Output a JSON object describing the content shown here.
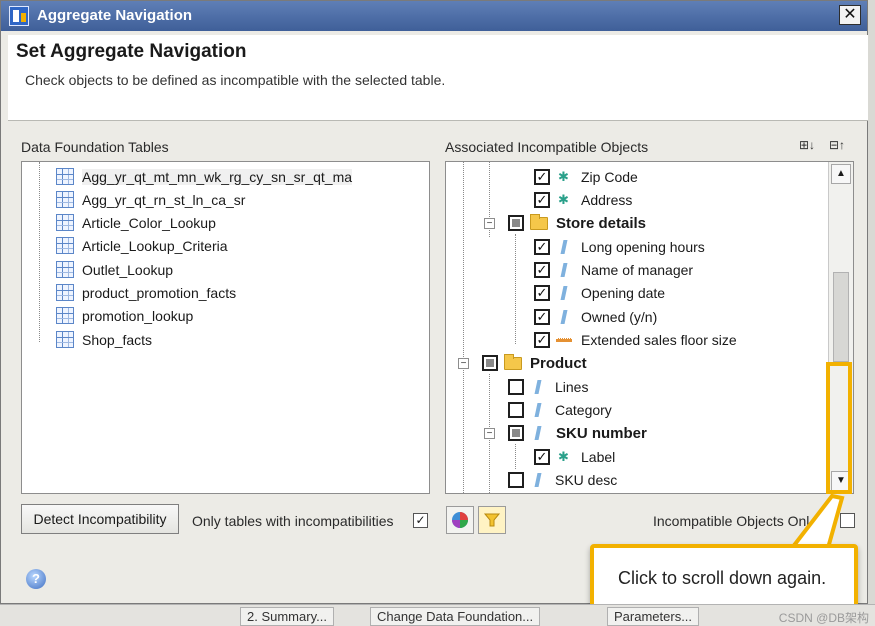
{
  "window": {
    "title": "Aggregate Navigation",
    "close_label": "✕"
  },
  "banner": {
    "heading": "Set Aggregate Navigation",
    "description": "Check objects to be defined as incompatible with the selected table."
  },
  "left": {
    "label": "Data Foundation Tables",
    "tables": [
      "Agg_yr_qt_mt_mn_wk_rg_cy_sn_sr_qt_ma",
      "Agg_yr_qt_rn_st_ln_ca_sr",
      "Article_Color_Lookup",
      "Article_Lookup_Criteria",
      "Outlet_Lookup",
      "product_promotion_facts",
      "promotion_lookup",
      "Shop_facts"
    ],
    "selected_index": 0
  },
  "right": {
    "label": "Associated Incompatible Objects",
    "expand_all": "⊞↓",
    "collapse_all": "⊟↑",
    "nodes": [
      {
        "label": "Zip Code",
        "type": "detail",
        "checked": true
      },
      {
        "label": "Address",
        "type": "detail",
        "checked": true
      },
      {
        "label": "Store details",
        "type": "folder",
        "checked": "partial",
        "expanded": true
      },
      {
        "label": "Long opening hours",
        "type": "dimension",
        "checked": true
      },
      {
        "label": "Name of manager",
        "type": "dimension",
        "checked": true
      },
      {
        "label": "Opening date",
        "type": "dimension",
        "checked": true
      },
      {
        "label": "Owned (y/n)",
        "type": "dimension",
        "checked": true
      },
      {
        "label": "Extended sales floor size",
        "type": "measure",
        "checked": true
      },
      {
        "label": "Product",
        "type": "folder",
        "checked": "partial",
        "expanded": true
      },
      {
        "label": "Lines",
        "type": "dimension",
        "checked": false
      },
      {
        "label": "Category",
        "type": "dimension",
        "checked": false
      },
      {
        "label": "SKU number",
        "type": "dimension-bold",
        "checked": "partial",
        "expanded": true
      },
      {
        "label": "Label",
        "type": "detail",
        "checked": true
      },
      {
        "label": "SKU desc",
        "type": "dimension",
        "checked": false
      }
    ],
    "scroll_up": "▲",
    "scroll_down": "▼"
  },
  "bottom": {
    "detect_button": "Detect Incompatibility",
    "only_tables_label": "Only tables with incompatibilities",
    "only_tables_checked": "✓",
    "incompatible_only_label": "Incompatible Objects Onl",
    "help": "?"
  },
  "callout": {
    "text": "Click to scroll down again."
  },
  "taskbar": {
    "items": [
      "2. Summary...",
      "Change Data Foundation...",
      "Parameters..."
    ],
    "watermark": "CSDN @DB架构"
  },
  "colors": {
    "highlight": "#f2b100",
    "titlebar": "#4f6fa8"
  }
}
